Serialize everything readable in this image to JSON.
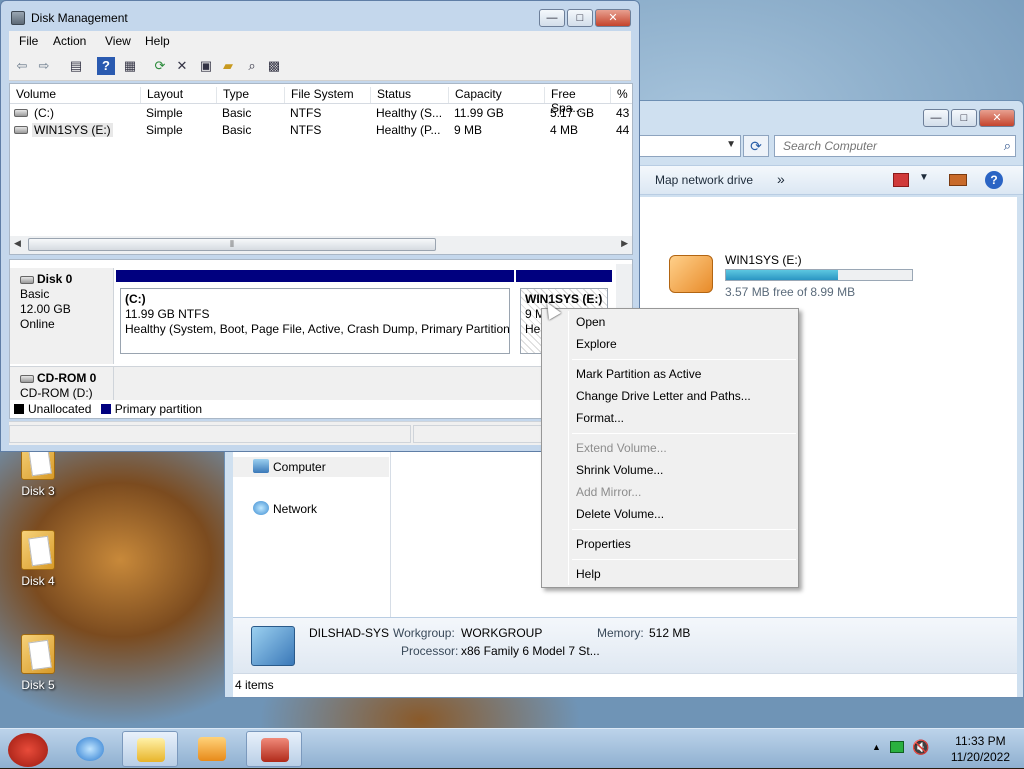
{
  "desktop": {
    "icons": [
      {
        "label": "Disk 3"
      },
      {
        "label": "Disk 4"
      },
      {
        "label": "Disk 5"
      }
    ]
  },
  "explorer": {
    "search_placeholder": "Search Computer",
    "cmd_map_drive": "Map network drive",
    "cmd_more": "»",
    "nav": {
      "computer": "Computer",
      "network": "Network"
    },
    "drive": {
      "name": "WIN1SYS (E:)",
      "free": "3.57 MB free of 8.99 MB",
      "used_fraction": 0.6
    },
    "details": {
      "pc_name": "DILSHAD-SYS",
      "workgroup_label": "Workgroup:",
      "workgroup": "WORKGROUP",
      "memory_label": "Memory:",
      "memory": "512 MB",
      "processor_label": "Processor:",
      "processor": "x86 Family 6 Model 7 St..."
    },
    "status": "4 items"
  },
  "dm": {
    "title": "Disk Management",
    "menu": [
      "File",
      "Action",
      "View",
      "Help"
    ],
    "columns": [
      "Volume",
      "Layout",
      "Type",
      "File System",
      "Status",
      "Capacity",
      "Free Spa...",
      "% F"
    ],
    "volumes": [
      {
        "volume": "(C:)",
        "layout": "Simple",
        "type": "Basic",
        "fs": "NTFS",
        "status": "Healthy (S...",
        "capacity": "11.99 GB",
        "free": "5.17 GB",
        "pct": "43"
      },
      {
        "volume": "WIN1SYS (E:)",
        "layout": "Simple",
        "type": "Basic",
        "fs": "NTFS",
        "status": "Healthy (P...",
        "capacity": "9 MB",
        "free": "4 MB",
        "pct": "44"
      }
    ],
    "disk0": {
      "name": "Disk 0",
      "type": "Basic",
      "size": "12.00 GB",
      "state": "Online"
    },
    "partC": {
      "title": "(C:)",
      "size": "11.99 GB NTFS",
      "status": "Healthy (System, Boot, Page File, Active, Crash Dump, Primary Partition)"
    },
    "partE": {
      "title": "WIN1SYS  (E:)",
      "size": "9 M",
      "status": "Hea"
    },
    "cdrom": {
      "name": "CD-ROM 0",
      "drive": "CD-ROM (D:)"
    },
    "legend": {
      "unallocated": "Unallocated",
      "primary": "Primary partition"
    },
    "colors": {
      "primary": "#00007f",
      "unallocated": "#000000"
    }
  },
  "context_menu": {
    "items": [
      {
        "label": "Open",
        "enabled": true
      },
      {
        "label": "Explore",
        "enabled": true
      },
      {
        "label": "Mark Partition as Active",
        "enabled": true
      },
      {
        "label": "Change Drive Letter and Paths...",
        "enabled": true
      },
      {
        "label": "Format...",
        "enabled": true
      },
      {
        "label": "Extend Volume...",
        "enabled": false
      },
      {
        "label": "Shrink Volume...",
        "enabled": true
      },
      {
        "label": "Add Mirror...",
        "enabled": false
      },
      {
        "label": "Delete Volume...",
        "enabled": true
      },
      {
        "label": "Properties",
        "enabled": true
      },
      {
        "label": "Help",
        "enabled": true
      }
    ]
  },
  "taskbar": {
    "time": "11:33 PM",
    "date": "11/20/2022"
  }
}
